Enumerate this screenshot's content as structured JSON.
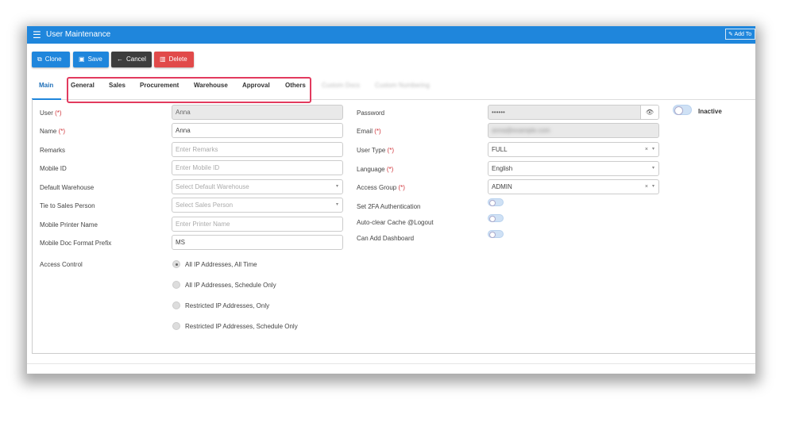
{
  "window": {
    "title": "User Maintenance",
    "add_to": "Add To"
  },
  "toolbar": {
    "clone": "Clone",
    "save": "Save",
    "cancel": "Cancel",
    "delete": "Delete"
  },
  "tabs": [
    {
      "label": "Main",
      "active": true
    },
    {
      "label": "General"
    },
    {
      "label": "Sales"
    },
    {
      "label": "Procurement"
    },
    {
      "label": "Warehouse"
    },
    {
      "label": "Approval"
    },
    {
      "label": "Others"
    }
  ],
  "blurred_tabs": [
    "Custom Docs",
    "Custom Numbering"
  ],
  "left": {
    "user": {
      "label": "User",
      "req": "(*)",
      "value": "Anna"
    },
    "name": {
      "label": "Name",
      "req": "(*)",
      "value": "Anna"
    },
    "remarks": {
      "label": "Remarks",
      "placeholder": "Enter Remarks"
    },
    "mobile_id": {
      "label": "Mobile ID",
      "placeholder": "Enter Mobile ID"
    },
    "default_warehouse": {
      "label": "Default Warehouse",
      "placeholder": "Select Default Warehouse"
    },
    "tie_sales": {
      "label": "Tie to Sales Person",
      "placeholder": "Select Sales Person"
    },
    "printer": {
      "label": "Mobile Printer Name",
      "placeholder": "Enter Printer Name"
    },
    "prefix": {
      "label": "Mobile Doc Format Prefix",
      "value": "MS"
    },
    "access_control": {
      "label": "Access Control"
    },
    "radios": [
      {
        "label": "All IP Addresses, All Time",
        "checked": true
      },
      {
        "label": "All IP Addresses, Schedule Only",
        "checked": false
      },
      {
        "label": "Restricted IP Addresses, Only",
        "checked": false
      },
      {
        "label": "Restricted IP Addresses, Schedule Only",
        "checked": false
      }
    ]
  },
  "right": {
    "password": {
      "label": "Password",
      "value": "••••••"
    },
    "email": {
      "label": "Email",
      "req": "(*)",
      "value": "anna@example.com"
    },
    "user_type": {
      "label": "User Type",
      "req": "(*)",
      "value": "FULL"
    },
    "language": {
      "label": "Language",
      "req": "(*)",
      "value": "English"
    },
    "access_group": {
      "label": "Access Group",
      "req": "(*)",
      "value": "ADMIN"
    },
    "twofa": {
      "label": "Set 2FA Authentication"
    },
    "autoclear": {
      "label": "Auto-clear Cache @Logout"
    },
    "dashboard": {
      "label": "Can Add Dashboard"
    },
    "inactive": {
      "label": "Inactive"
    }
  },
  "icons": {
    "menu": "☰",
    "clone": "⧉",
    "save": "💾",
    "cancel": "←",
    "delete": "🗑",
    "eye": "👁",
    "caret": "▾",
    "clear": "×",
    "pencil": "✎"
  }
}
